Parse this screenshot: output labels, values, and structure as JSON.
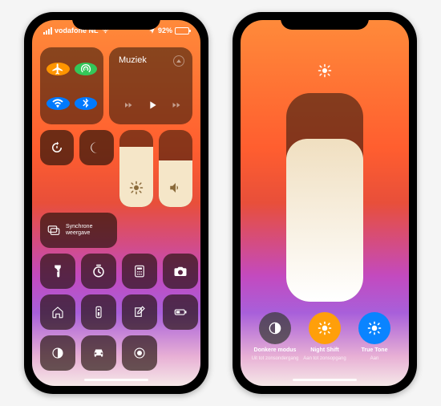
{
  "status": {
    "carrier": "vodafone NL",
    "battery_pct": "92%"
  },
  "music": {
    "title": "Muziek"
  },
  "mirroring_label": "Synchrone weergave",
  "brightness_level": 0.78,
  "volume_level": 0.6,
  "big_brightness_level": 0.78,
  "modes": {
    "dark": {
      "label": "Donkere modus",
      "sub": "Uit tot zonsondergang"
    },
    "nightshift": {
      "label": "Night Shift",
      "sub": "Aan tot zonsopgang"
    },
    "truetone": {
      "label": "True Tone",
      "sub": "Aan"
    }
  }
}
